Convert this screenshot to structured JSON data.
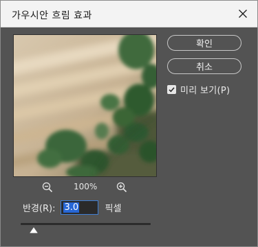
{
  "dialog": {
    "title": "가우시안 흐림 효과",
    "close_icon": "close-icon"
  },
  "buttons": {
    "ok_label": "확인",
    "cancel_label": "취소"
  },
  "preview_checkbox": {
    "label": "미리 보기(P)",
    "checked": true
  },
  "zoom": {
    "zoom_out_icon": "zoom-out-icon",
    "level": "100%",
    "zoom_in_icon": "zoom-in-icon"
  },
  "radius": {
    "label": "반경(R):",
    "value": "3.0",
    "unit": "픽셀",
    "slider_fraction": 0.1
  },
  "colors": {
    "dialog_bg": "#535353",
    "titlebar_bg": "#f3f3f3",
    "input_highlight": "#2767d6"
  }
}
